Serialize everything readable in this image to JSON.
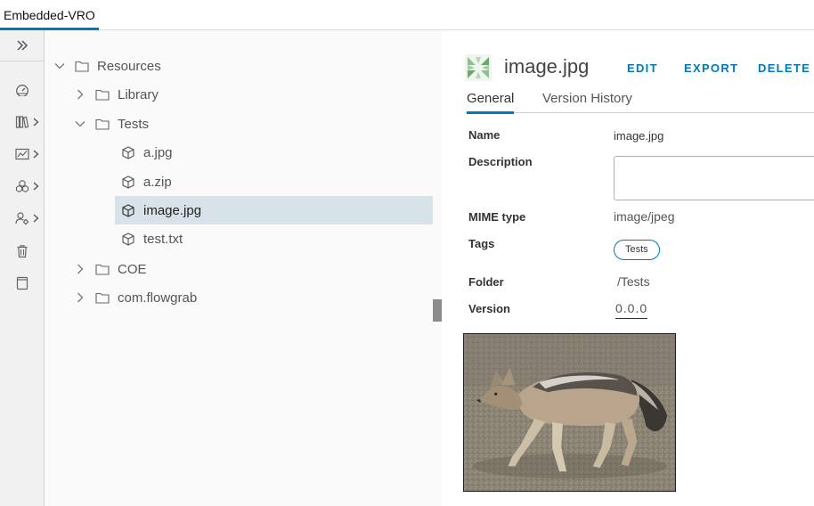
{
  "app_tab": {
    "label": "Embedded-VRO"
  },
  "rail": {
    "items": [
      {
        "icon": "expand-double-chevron-icon"
      },
      {
        "icon": "dashboard-icon"
      },
      {
        "icon": "library-icon"
      },
      {
        "icon": "monitoring-icon"
      },
      {
        "icon": "assets-icon"
      },
      {
        "icon": "administration-icon"
      },
      {
        "icon": "trash-icon"
      },
      {
        "icon": "tablet-icon"
      }
    ]
  },
  "tree": {
    "items": [
      {
        "label": "Resources",
        "icon": "folder-icon",
        "expanded": true
      },
      {
        "label": "Library",
        "icon": "folder-icon",
        "expanded": false
      },
      {
        "label": "Tests",
        "icon": "folder-icon",
        "expanded": true
      },
      {
        "label": "a.jpg",
        "icon": "resource-cube-icon"
      },
      {
        "label": "a.zip",
        "icon": "resource-cube-icon"
      },
      {
        "label": "image.jpg",
        "icon": "resource-cube-icon",
        "selected": true
      },
      {
        "label": "test.txt",
        "icon": "resource-cube-icon"
      },
      {
        "label": "COE",
        "icon": "folder-icon",
        "expanded": false
      },
      {
        "label": "com.flowgrab",
        "icon": "folder-icon",
        "expanded": false
      }
    ]
  },
  "detail": {
    "title": "image.jpg",
    "actions": {
      "edit": "EDIT",
      "export": "EXPORT",
      "delete": "DELETE"
    },
    "tabs": {
      "general": "General",
      "version_history": "Version History"
    },
    "fields": {
      "name_label": "Name",
      "name_value": "image.jpg",
      "description_label": "Description",
      "description_value": "",
      "mime_label": "MIME type",
      "mime_value": "image/jpeg",
      "tags_label": "Tags",
      "tag_1": "Tests",
      "folder_label": "Folder",
      "folder_value": "/Tests",
      "version_label": "Version",
      "version_value": "0.0.0"
    },
    "preview_subject": "jackal-photo"
  },
  "colors": {
    "accent": "#0079b8",
    "selected_row": "#d8e3e9",
    "rail_bg": "#f1f1f1",
    "tree_bg": "#fafafa"
  }
}
